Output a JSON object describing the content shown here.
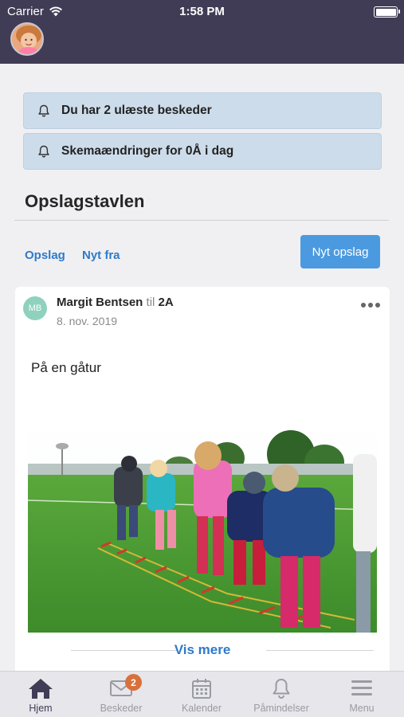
{
  "status_bar": {
    "carrier": "Carrier",
    "time": "1:58 PM"
  },
  "notifications": [
    {
      "text": "Du har 2 ulæste beskeder",
      "icon": "bell-icon"
    },
    {
      "text": "Skemaændringer for 0Å i dag",
      "icon": "bell-icon"
    }
  ],
  "board": {
    "title": "Opslagstavlen",
    "tabs": [
      "Opslag",
      "Nyt fra"
    ],
    "new_post_label": "Nyt opslag"
  },
  "post": {
    "initials": "MB",
    "author": "Margit Bentsen",
    "to_word": "til",
    "class_name": "2A",
    "date": "8. nov. 2019",
    "text": "På en gåtur",
    "show_more": "Vis mere"
  },
  "tabbar": {
    "items": [
      {
        "label": "Hjem",
        "icon": "home-icon"
      },
      {
        "label": "Beskeder",
        "icon": "envelope-icon",
        "badge": "2"
      },
      {
        "label": "Kalender",
        "icon": "calendar-icon"
      },
      {
        "label": "Påmindelser",
        "icon": "bell-icon"
      },
      {
        "label": "Menu",
        "icon": "menu-icon"
      }
    ]
  },
  "colors": {
    "header": "#413c55",
    "accent": "#2f7ac8",
    "button": "#4b9ae0",
    "badge": "#d9703c",
    "notice": "#cddcea"
  }
}
